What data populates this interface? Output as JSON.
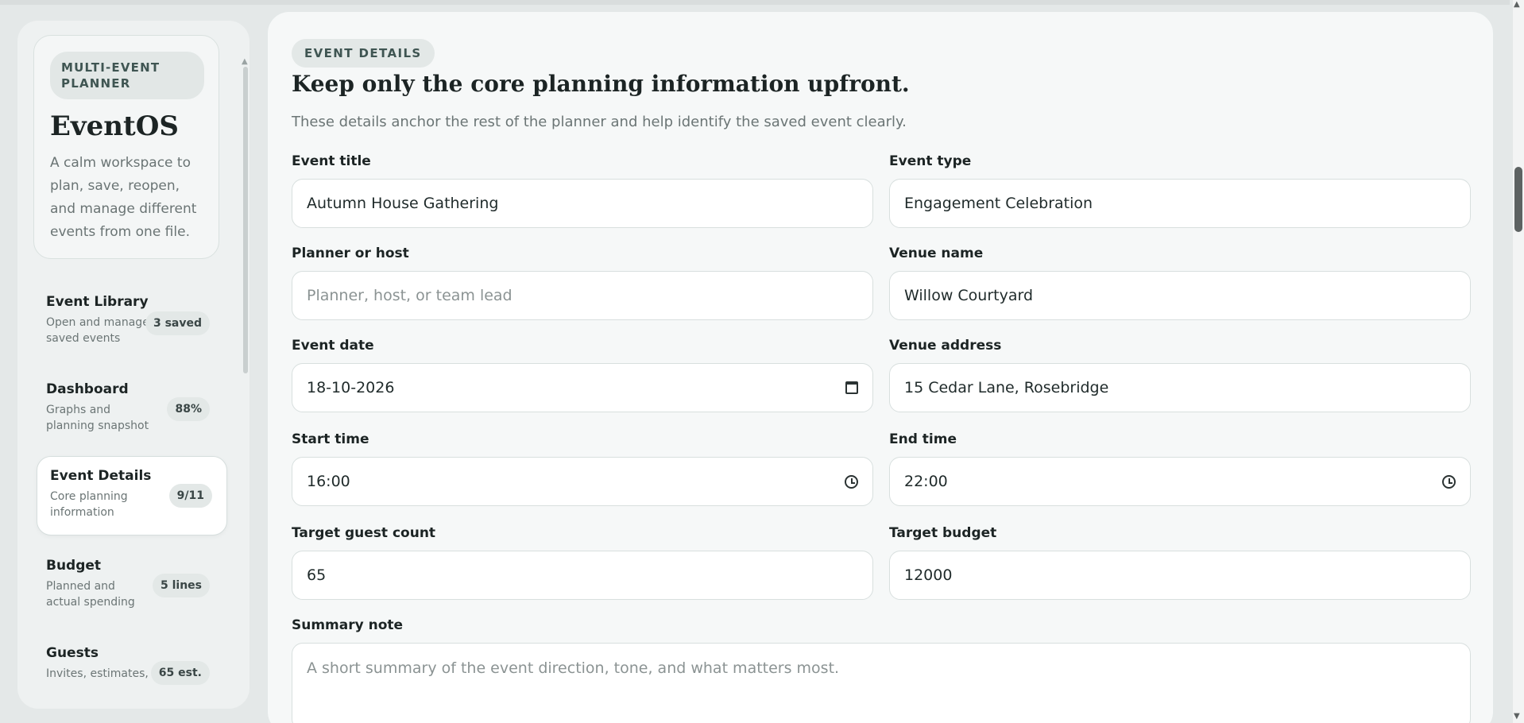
{
  "sidebar": {
    "brand_pill": "MULTI-EVENT PLANNER",
    "brand_title": "EventOS",
    "brand_desc": "A calm workspace to plan, save, reopen, and manage different events from one file.",
    "nav": [
      {
        "title": "Event Library",
        "sub": "Open and manage saved events",
        "badge": "3 saved"
      },
      {
        "title": "Dashboard",
        "sub": "Graphs and planning snapshot",
        "badge": "88%"
      },
      {
        "title": "Event Details",
        "sub": "Core planning information",
        "badge": "9/11",
        "active": true
      },
      {
        "title": "Budget",
        "sub": "Planned and actual spending",
        "badge": "5 lines"
      },
      {
        "title": "Guests",
        "sub": "Invites, estimates,",
        "badge": "65 est."
      }
    ]
  },
  "main": {
    "section_pill": "EVENT DETAILS",
    "heading": "Keep only the core planning information upfront.",
    "subheading": "These details anchor the rest of the planner and help identify the saved event clearly.",
    "fields": {
      "event_title": {
        "label": "Event title",
        "value": "Autumn House Gathering"
      },
      "event_type": {
        "label": "Event type",
        "value": "Engagement Celebration"
      },
      "planner": {
        "label": "Planner or host",
        "placeholder": "Planner, host, or team lead"
      },
      "venue_name": {
        "label": "Venue name",
        "value": "Willow Courtyard"
      },
      "event_date": {
        "label": "Event date",
        "value": "18-10-2026"
      },
      "venue_address": {
        "label": "Venue address",
        "value": "15 Cedar Lane, Rosebridge"
      },
      "start_time": {
        "label": "Start time",
        "value": "16:00"
      },
      "end_time": {
        "label": "End time",
        "value": "22:00"
      },
      "guest_count": {
        "label": "Target guest count",
        "value": "65"
      },
      "budget": {
        "label": "Target budget",
        "value": "12000"
      },
      "summary": {
        "label": "Summary note",
        "placeholder": "A short summary of the event direction, tone, and what matters most."
      }
    }
  },
  "icons": {
    "calendar": "calendar-icon",
    "clock": "clock-icon"
  }
}
